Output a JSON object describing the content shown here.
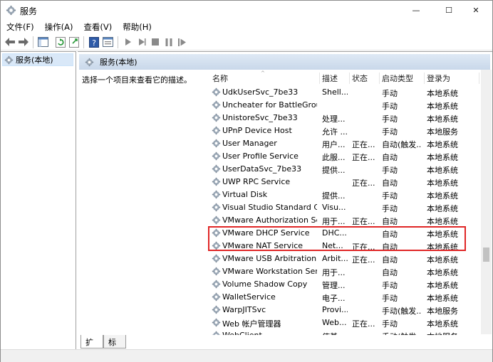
{
  "window": {
    "title": "服务",
    "controls": {
      "minimize": "—",
      "maximize": "☐",
      "close": "✕"
    }
  },
  "menu": [
    "文件(F)",
    "操作(A)",
    "查看(V)",
    "帮助(H)"
  ],
  "toolbar": {
    "icons": [
      "back-icon",
      "forward-icon",
      "show-hide-tree-icon",
      "refresh-icon",
      "export-icon",
      "help-icon",
      "properties-icon",
      "start-service-icon",
      "start-service-alt-icon",
      "stop-service-icon",
      "pause-service-icon",
      "restart-service-icon"
    ]
  },
  "tree": {
    "root_label": "服务(本地)"
  },
  "pane": {
    "header": "服务(本地)",
    "description_prompt": "选择一个项目来查看它的描述。"
  },
  "columns": [
    "名称",
    "描述",
    "状态",
    "启动类型",
    "登录为"
  ],
  "services": [
    {
      "name": "UdkUserSvc_7be33",
      "desc": "Shell...",
      "status": "",
      "startup": "手动",
      "logon": "本地系统"
    },
    {
      "name": "Uncheater for BattleGroun...",
      "desc": "",
      "status": "",
      "startup": "手动",
      "logon": "本地系统"
    },
    {
      "name": "UnistoreSvc_7be33",
      "desc": "处理...",
      "status": "",
      "startup": "手动",
      "logon": "本地系统"
    },
    {
      "name": "UPnP Device Host",
      "desc": "允许 ...",
      "status": "",
      "startup": "手动",
      "logon": "本地服务"
    },
    {
      "name": "User Manager",
      "desc": "用户...",
      "status": "正在...",
      "startup": "自动(触发...",
      "logon": "本地系统"
    },
    {
      "name": "User Profile Service",
      "desc": "此服...",
      "status": "正在...",
      "startup": "自动",
      "logon": "本地系统"
    },
    {
      "name": "UserDataSvc_7be33",
      "desc": "提供...",
      "status": "",
      "startup": "手动",
      "logon": "本地系统"
    },
    {
      "name": "UWP RPC Service",
      "desc": "",
      "status": "正在...",
      "startup": "自动",
      "logon": "本地系统"
    },
    {
      "name": "Virtual Disk",
      "desc": "提供...",
      "status": "",
      "startup": "手动",
      "logon": "本地系统"
    },
    {
      "name": "Visual Studio Standard Coll...",
      "desc": "Visu...",
      "status": "",
      "startup": "手动",
      "logon": "本地系统"
    },
    {
      "name": "VMware Authorization Ser...",
      "desc": "用于...",
      "status": "正在...",
      "startup": "自动",
      "logon": "本地系统"
    },
    {
      "name": "VMware DHCP Service",
      "desc": "DHC...",
      "status": "",
      "startup": "自动",
      "logon": "本地系统"
    },
    {
      "name": "VMware NAT Service",
      "desc": "Net...",
      "status": "正在...",
      "startup": "自动",
      "logon": "本地系统"
    },
    {
      "name": "VMware USB Arbitration S...",
      "desc": "Arbit...",
      "status": "正在...",
      "startup": "自动",
      "logon": "本地系统"
    },
    {
      "name": "VMware Workstation Server",
      "desc": "用于...",
      "status": "",
      "startup": "自动",
      "logon": "本地系统"
    },
    {
      "name": "Volume Shadow Copy",
      "desc": "管理...",
      "status": "",
      "startup": "手动",
      "logon": "本地系统"
    },
    {
      "name": "WalletService",
      "desc": "电子...",
      "status": "",
      "startup": "手动",
      "logon": "本地系统"
    },
    {
      "name": "WarpJITSvc",
      "desc": "Provi...",
      "status": "",
      "startup": "手动(触发...",
      "logon": "本地服务"
    },
    {
      "name": "Web 帐户管理器",
      "desc": "Web...",
      "status": "正在...",
      "startup": "手动",
      "logon": "本地系统"
    },
    {
      "name": "WebClient",
      "desc": "使基...",
      "status": "",
      "startup": "手动(触发...",
      "logon": "本地服务"
    }
  ],
  "highlighted_services": [
    "VMware DHCP Service",
    "VMware NAT Service"
  ],
  "highlight_color": "#e02626",
  "tabs": [
    "扩展",
    "标准"
  ]
}
